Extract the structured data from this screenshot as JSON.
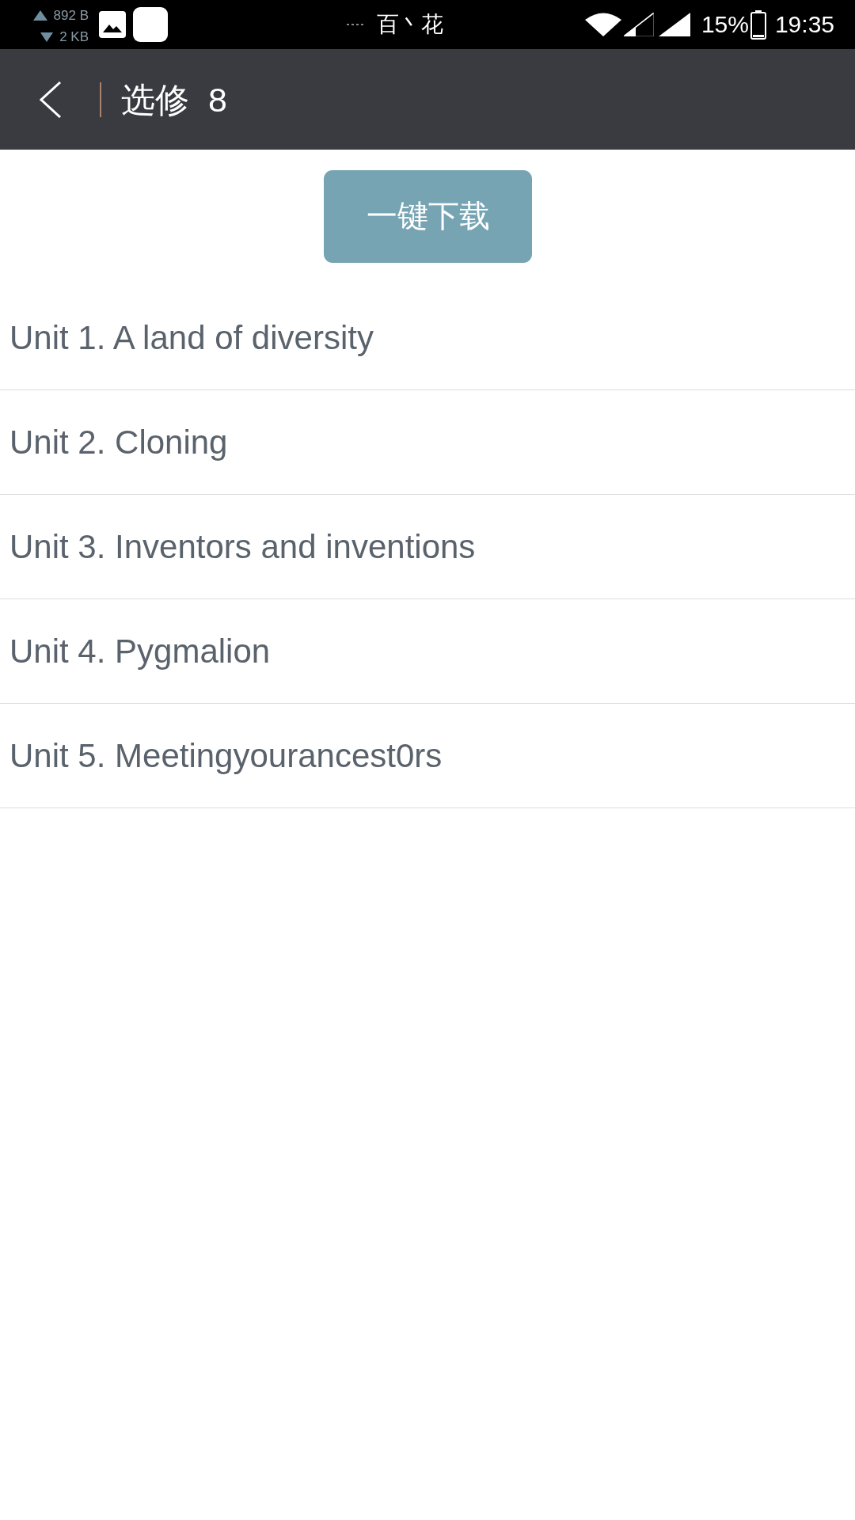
{
  "status_bar": {
    "upload_speed": "892 B",
    "download_speed": "2 KB",
    "notification_text": "百丶花",
    "battery_percent": "15%",
    "time": "19:35"
  },
  "header": {
    "title": "选修 8"
  },
  "download_all_button": {
    "label": "一键下载"
  },
  "units": [
    {
      "title": "Unit 1. A land of diversity"
    },
    {
      "title": "Unit 2. Cloning"
    },
    {
      "title": "Unit 3. Inventors and inventions"
    },
    {
      "title": "Unit 4. Pygmalion"
    },
    {
      "title": "Unit 5. Meetingyourancest0rs"
    }
  ]
}
